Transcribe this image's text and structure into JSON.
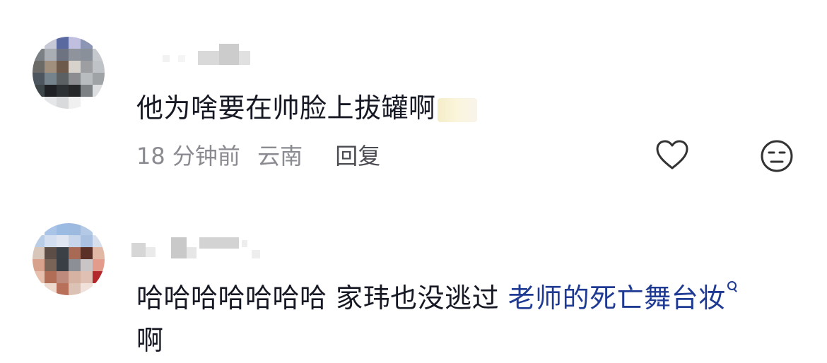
{
  "comments": [
    {
      "text": "他为啥要在帅脸上拔罐啊",
      "time": "18 分钟前",
      "location": "云南",
      "reply_label": "回复"
    },
    {
      "text_main": "哈哈哈哈哈哈哈 家玮也没逃过 ",
      "text_link": "老师的死亡舞台妆",
      "text_tail": "啊"
    }
  ],
  "icons": {
    "like": "heart-outline-icon",
    "dislike": "meh-face-icon",
    "search": "search-icon"
  },
  "colors": {
    "text": "#161823",
    "meta": "#8a8b91",
    "link": "#1f3a93"
  }
}
